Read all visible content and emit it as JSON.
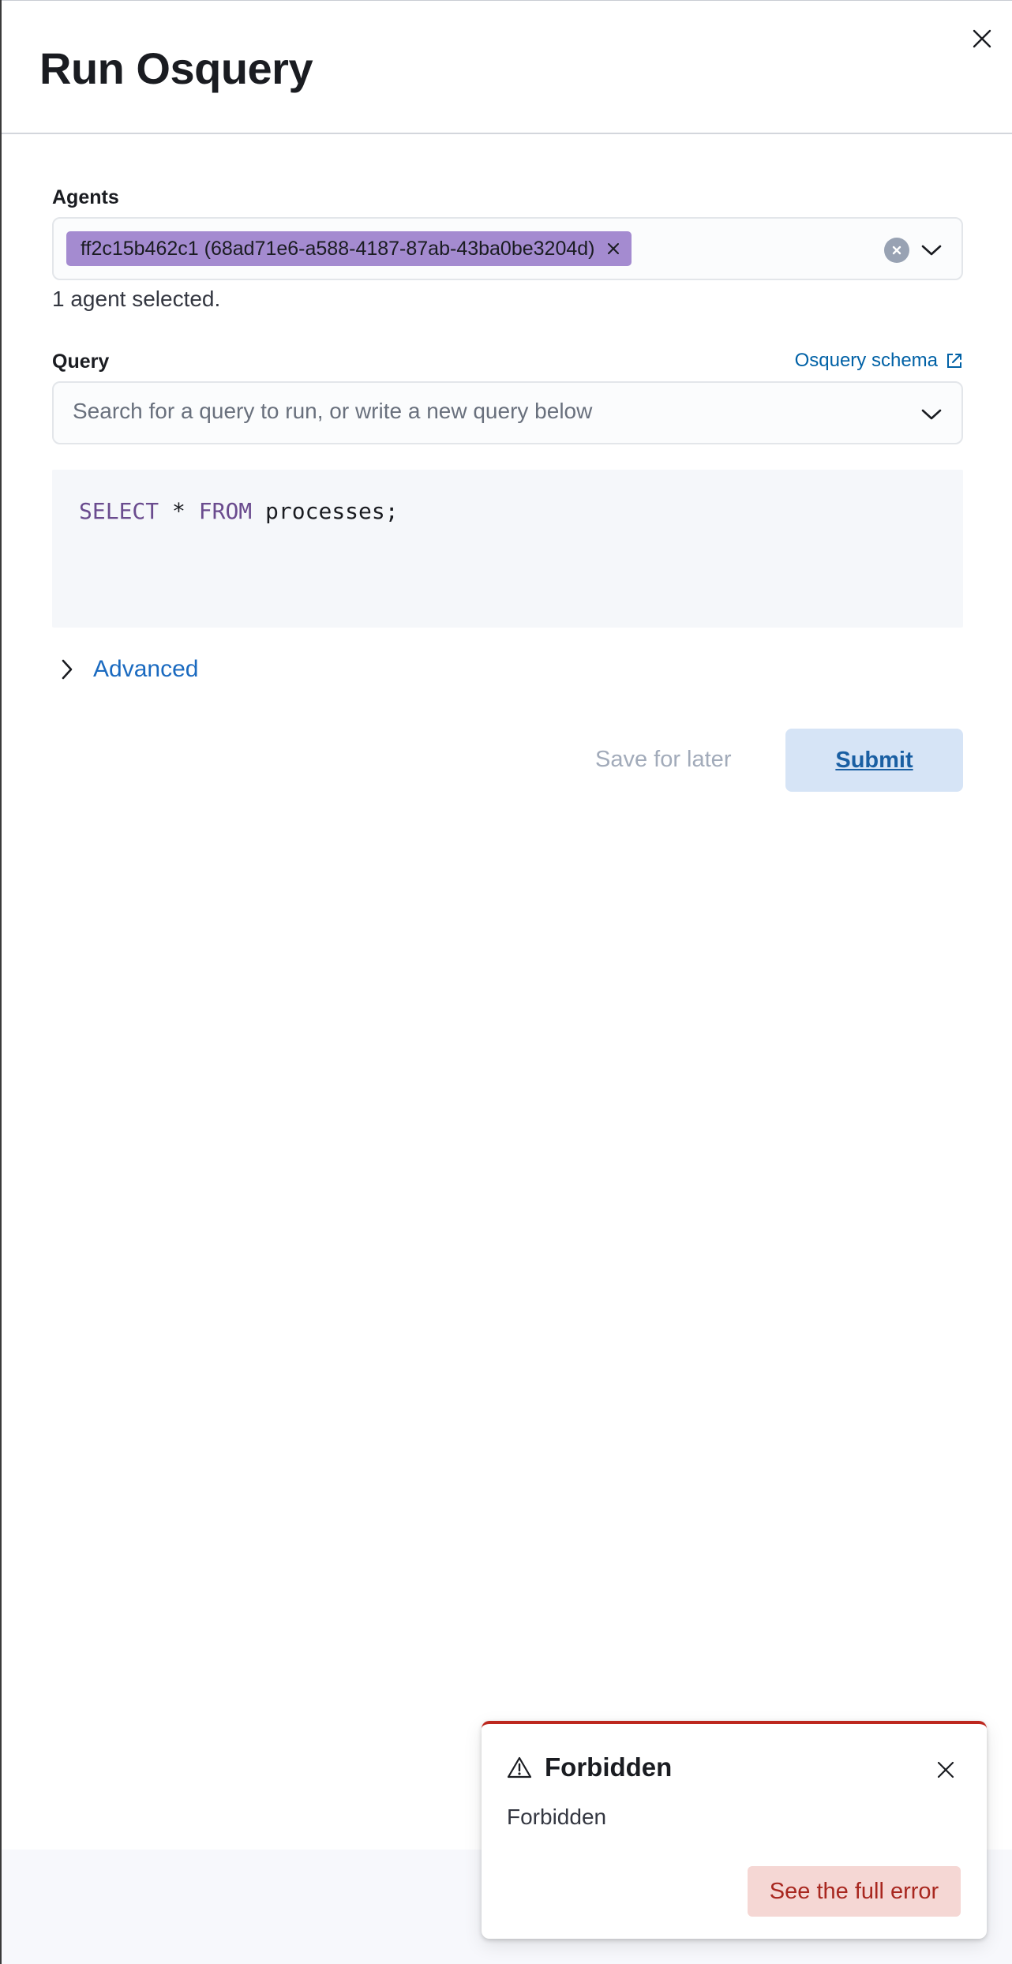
{
  "flyout": {
    "title": "Run Osquery"
  },
  "agents": {
    "label": "Agents",
    "selected_chip": "ff2c15b462c1 (68ad71e6-a588-4187-87ab-43ba0be3204d)",
    "helper_text": "1 agent selected."
  },
  "query": {
    "label": "Query",
    "schema_link": "Osquery schema",
    "search_placeholder": "Search for a query to run, or write a new query below",
    "code": {
      "kw_select": "SELECT",
      "star": " * ",
      "kw_from": "FROM",
      "rest": " processes;"
    }
  },
  "advanced": {
    "label": "Advanced"
  },
  "actions": {
    "save_later": "Save for later",
    "submit": "Submit"
  },
  "toast": {
    "title": "Forbidden",
    "body": "Forbidden",
    "button": "See the full error"
  },
  "colors": {
    "chip_bg": "#a48bd0",
    "link": "#0061a6",
    "danger": "#bd271e",
    "submit_bg": "#d6e4f6"
  },
  "icons": {
    "close": "close-icon",
    "chip_remove": "close-icon",
    "clear": "clear-circle-icon",
    "dropdown": "chevron-down-icon",
    "external": "external-link-icon",
    "expand": "chevron-right-icon",
    "warning": "warning-icon"
  }
}
